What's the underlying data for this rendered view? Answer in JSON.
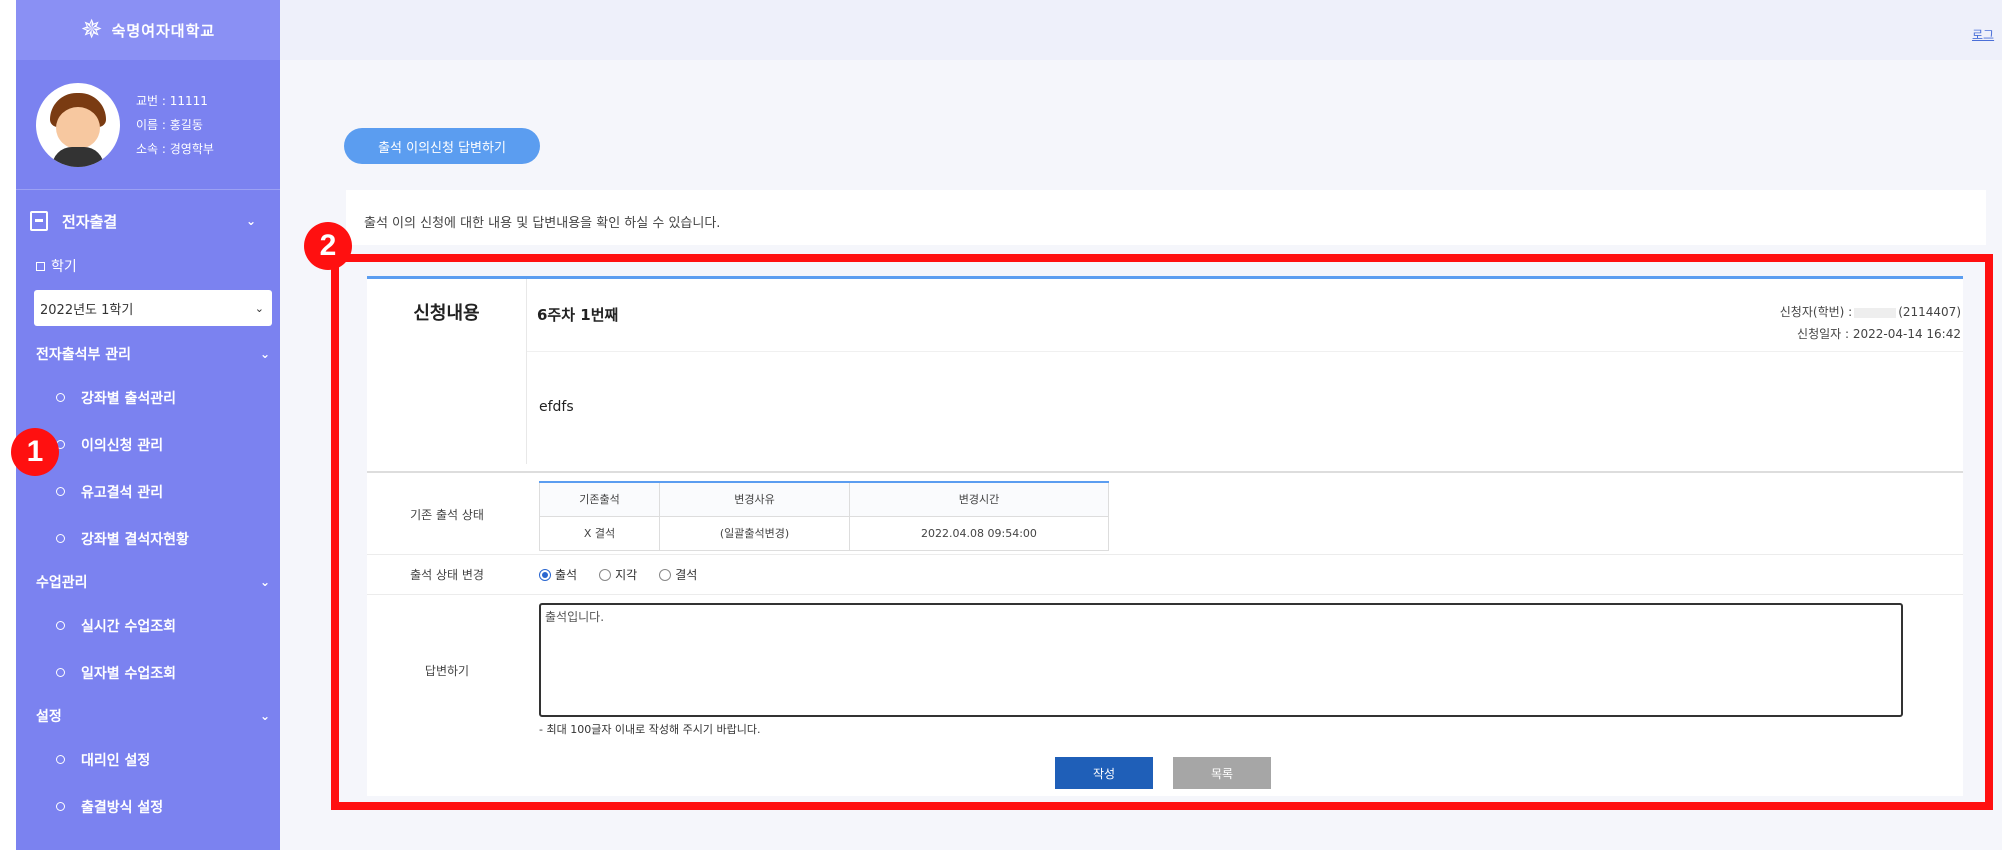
{
  "sidebar": {
    "logo_text": "숙명여자대학교",
    "profile": {
      "id_line": "교번 : 11111",
      "name_line": "이름 : 홍길동",
      "dept_line": "소속 : 경영학부"
    },
    "section_title": "전자출결",
    "semester_label": "학기",
    "semester_value": "2022년도 1학기",
    "groups": [
      {
        "title": "전자출석부 관리",
        "items": [
          "강좌별 출석관리",
          "이의신청 관리",
          "유고결석 관리",
          "강좌별 결석자현황"
        ]
      },
      {
        "title": "수업관리",
        "items": [
          "실시간 수업조회",
          "일자별 수업조회"
        ]
      },
      {
        "title": "설정",
        "items": [
          "대리인 설정",
          "출결방식 설정"
        ]
      }
    ]
  },
  "header": {
    "login_link": "로그"
  },
  "page": {
    "title_pill": "출석 이의신청 답변하기",
    "description": "출석 이의 신청에 대한 내용 및 답변내용을 확인 하실 수 있습니다."
  },
  "request": {
    "label": "신청내용",
    "title": "6주차 1번째",
    "applicant_prefix": "신청자(학번) :",
    "applicant_id": "(2114407)",
    "date_line": "신청일자 : 2022-04-14 16:42",
    "body": "efdfs"
  },
  "status": {
    "label": "기존 출석 상태",
    "headers": [
      "기존출석",
      "변경사유",
      "변경시간"
    ],
    "row": [
      "X 결석",
      "(일괄출석변경)",
      "2022.04.08 09:54:00"
    ]
  },
  "change": {
    "label": "출석 상태 변경",
    "options": [
      "출석",
      "지각",
      "결석"
    ],
    "selected": "출석"
  },
  "answer": {
    "label": "답변하기",
    "value": "출석입니다.",
    "hint": "- 최대 100글자 이내로 작성해 주시기 바랍니다."
  },
  "buttons": {
    "submit": "작성",
    "list": "목록"
  },
  "annotations": {
    "badge1": "1",
    "badge2": "2",
    "color": "#ff1010"
  }
}
